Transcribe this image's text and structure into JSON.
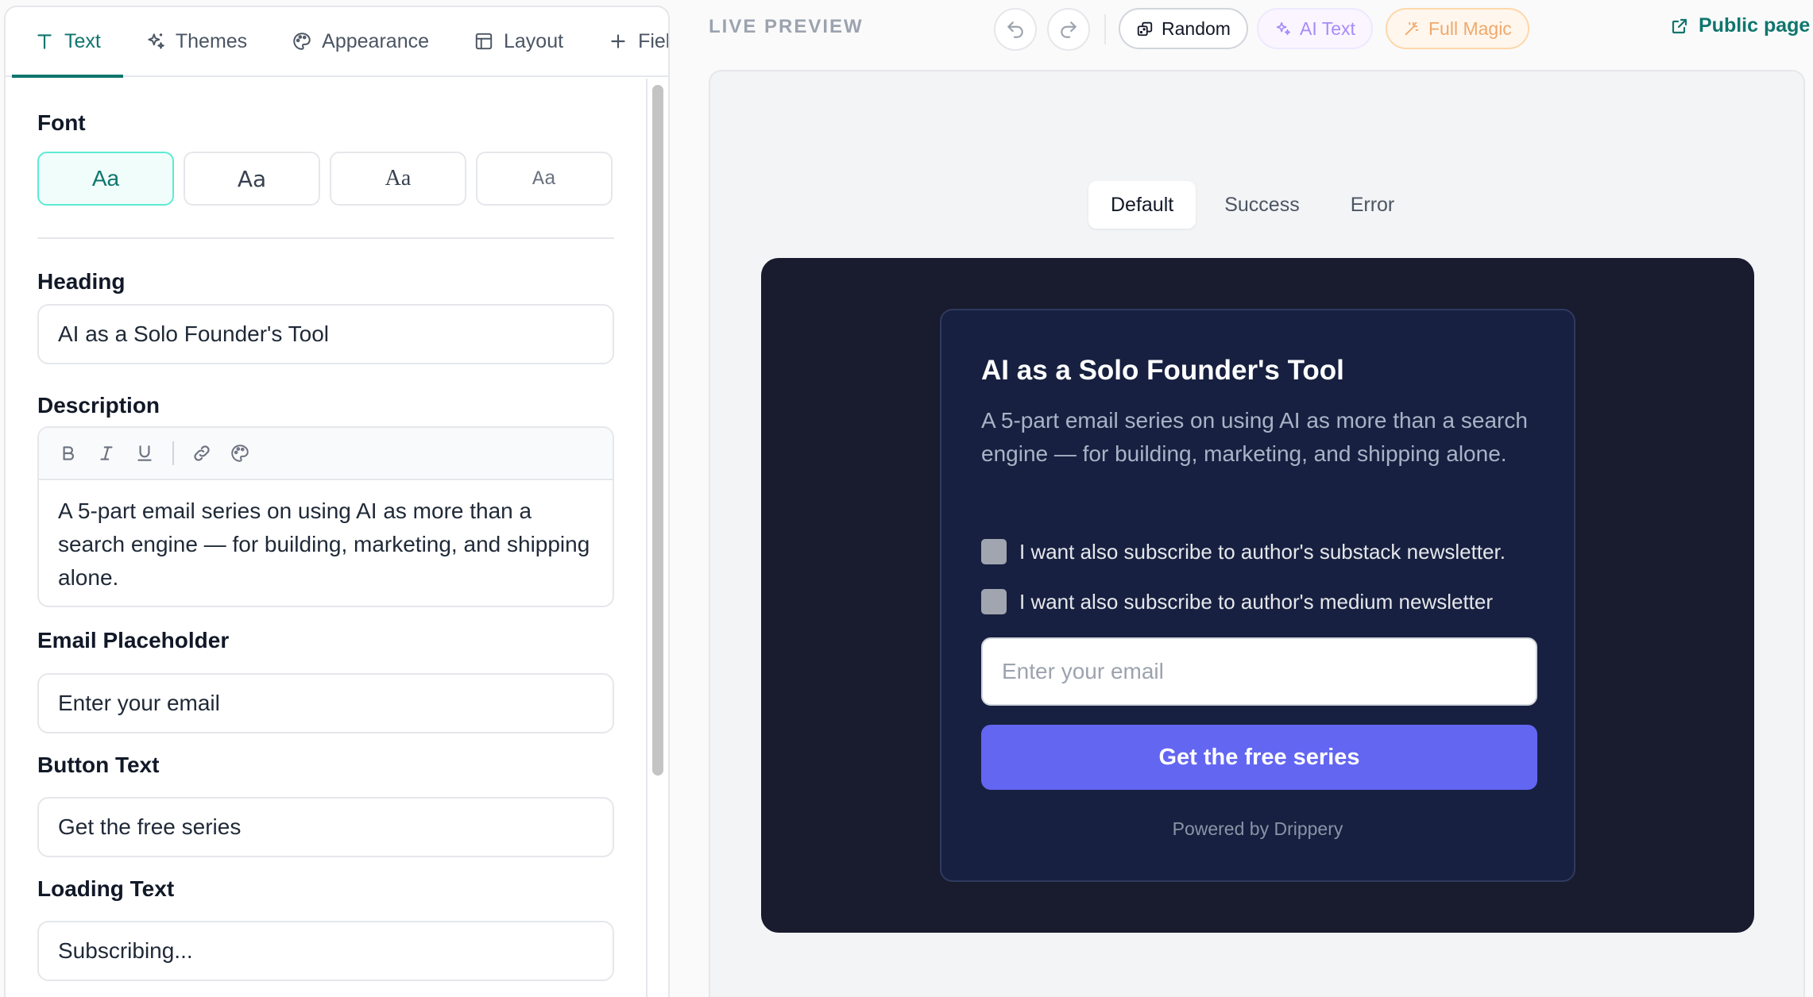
{
  "tabs": [
    {
      "label": "Text",
      "icon": "text-icon",
      "active": true
    },
    {
      "label": "Themes",
      "icon": "sparkles-icon"
    },
    {
      "label": "Appearance",
      "icon": "palette-icon"
    },
    {
      "label": "Layout",
      "icon": "layout-icon"
    },
    {
      "label": "Fields",
      "icon": "plus-icon"
    }
  ],
  "editor": {
    "font_label": "Font",
    "font_options": [
      "Aa",
      "Aa",
      "Aa",
      "Aa"
    ],
    "heading_label": "Heading",
    "heading_value": "AI as a Solo Founder's Tool",
    "description_label": "Description",
    "description_value": "A 5-part email series on using AI as more than a search engine — for building, marketing, and shipping alone.",
    "email_placeholder_label": "Email Placeholder",
    "email_placeholder_value": "Enter your email",
    "button_text_label": "Button Text",
    "button_text_value": "Get the free series",
    "loading_text_label": "Loading Text",
    "loading_text_value": "Subscribing..."
  },
  "topbar": {
    "live_preview": "LIVE PREVIEW",
    "random": "Random",
    "ai_text": "AI Text",
    "full_magic": "Full Magic",
    "public_page": "Public page"
  },
  "preview": {
    "states": [
      "Default",
      "Success",
      "Error"
    ],
    "active_state": "Default",
    "title": "AI as a Solo Founder's Tool",
    "description": "A 5-part email series on using AI as more than a search engine — for building, marketing, and shipping alone.",
    "checkbox_1": "I want also subscribe to author's substack newsletter.",
    "checkbox_2": "I want also subscribe to author's medium newsletter",
    "email_placeholder": "Enter your email",
    "button": "Get the free series",
    "powered_by": "Powered by Drippery"
  },
  "colors": {
    "accent": "#0f766e",
    "dark_bg": "#191b2e",
    "card_bg": "#172040",
    "button": "#6366f1"
  }
}
